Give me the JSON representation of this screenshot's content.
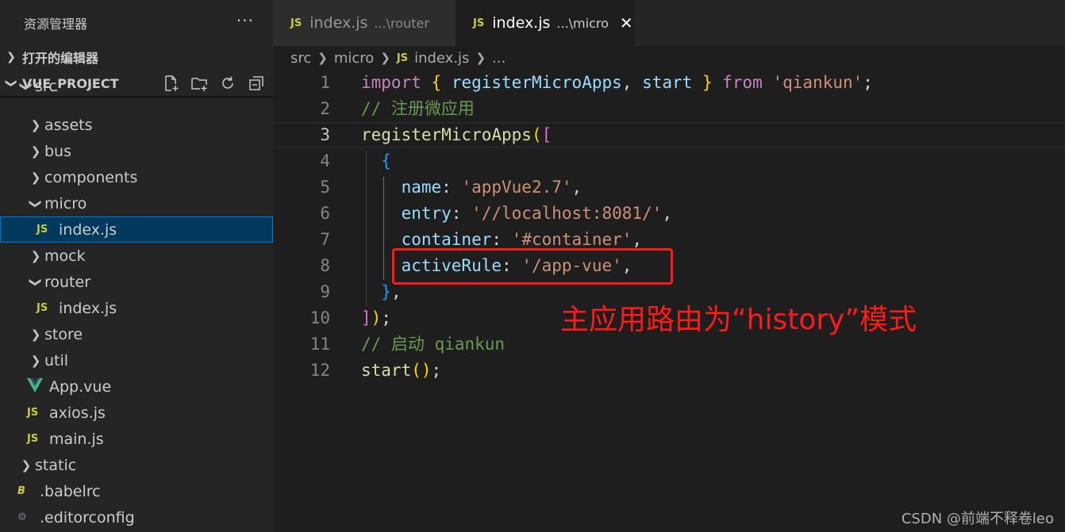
{
  "sidebar": {
    "title": "资源管理器",
    "more_glyph": "···",
    "open_editors_label": "打开的编辑器",
    "project_label": "VUE_PROJECT",
    "actions": [
      "new-file-icon",
      "new-folder-icon",
      "refresh-icon",
      "collapse-all-icon"
    ],
    "tree": [
      {
        "label": "src",
        "kind": "folder",
        "expanded": true,
        "depth": 1,
        "partial": true
      },
      {
        "label": "assets",
        "kind": "folder",
        "expanded": false,
        "depth": 2
      },
      {
        "label": "bus",
        "kind": "folder",
        "expanded": false,
        "depth": 2
      },
      {
        "label": "components",
        "kind": "folder",
        "expanded": false,
        "depth": 2
      },
      {
        "label": "micro",
        "kind": "folder",
        "expanded": true,
        "depth": 2
      },
      {
        "label": "index.js",
        "kind": "js",
        "depth": 3,
        "selected": true
      },
      {
        "label": "mock",
        "kind": "folder",
        "expanded": false,
        "depth": 2
      },
      {
        "label": "router",
        "kind": "folder",
        "expanded": true,
        "depth": 2
      },
      {
        "label": "index.js",
        "kind": "js",
        "depth": 3
      },
      {
        "label": "store",
        "kind": "folder",
        "expanded": false,
        "depth": 2
      },
      {
        "label": "util",
        "kind": "folder",
        "expanded": false,
        "depth": 2
      },
      {
        "label": "App.vue",
        "kind": "vue",
        "depth": 2
      },
      {
        "label": "axios.js",
        "kind": "js",
        "depth": 2
      },
      {
        "label": "main.js",
        "kind": "js",
        "depth": 2
      },
      {
        "label": "static",
        "kind": "folder",
        "expanded": false,
        "depth": 1
      },
      {
        "label": ".babelrc",
        "kind": "babel",
        "depth": 1
      },
      {
        "label": ".editorconfig",
        "kind": "config",
        "depth": 1
      }
    ]
  },
  "tabs": [
    {
      "icon": "JS",
      "label": "index.js",
      "desc": "...\\router",
      "active": false
    },
    {
      "icon": "JS",
      "label": "index.js",
      "desc": "...\\micro",
      "active": true,
      "close": "✕"
    }
  ],
  "breadcrumb": [
    "src",
    "micro",
    "JS",
    "index.js",
    "..."
  ],
  "code": {
    "current_line": 3,
    "lines": [
      {
        "n": "1",
        "tokens": [
          [
            "kw",
            "import"
          ],
          [
            "pn",
            " "
          ],
          [
            "br1",
            "{"
          ],
          [
            "pn",
            " "
          ],
          [
            "id",
            "registerMicroApps"
          ],
          [
            "pn",
            ", "
          ],
          [
            "id",
            "start"
          ],
          [
            "pn",
            " "
          ],
          [
            "br1",
            "}"
          ],
          [
            "pn",
            " "
          ],
          [
            "kw",
            "from"
          ],
          [
            "pn",
            " "
          ],
          [
            "str",
            "'qiankun'"
          ],
          [
            "pn",
            ";"
          ]
        ]
      },
      {
        "n": "2",
        "tokens": [
          [
            "cm",
            "// 注册微应用"
          ]
        ]
      },
      {
        "n": "3",
        "tokens": [
          [
            "fn",
            "registerMicroApps"
          ],
          [
            "br1",
            "("
          ],
          [
            "br2",
            "["
          ]
        ]
      },
      {
        "n": "4",
        "tokens": [
          [
            "pn",
            "  "
          ],
          [
            "br3",
            "{"
          ]
        ]
      },
      {
        "n": "5",
        "tokens": [
          [
            "pn",
            "    "
          ],
          [
            "id",
            "name"
          ],
          [
            "pn",
            ": "
          ],
          [
            "str",
            "'appVue2.7'"
          ],
          [
            "pn",
            ","
          ]
        ]
      },
      {
        "n": "6",
        "tokens": [
          [
            "pn",
            "    "
          ],
          [
            "id",
            "entry"
          ],
          [
            "pn",
            ": "
          ],
          [
            "str",
            "'//localhost:8081/'"
          ],
          [
            "pn",
            ","
          ]
        ]
      },
      {
        "n": "7",
        "tokens": [
          [
            "pn",
            "    "
          ],
          [
            "id",
            "container"
          ],
          [
            "pn",
            ": "
          ],
          [
            "str",
            "'#container'"
          ],
          [
            "pn",
            ","
          ]
        ]
      },
      {
        "n": "8",
        "tokens": [
          [
            "pn",
            "    "
          ],
          [
            "id",
            "activeRule"
          ],
          [
            "pn",
            ": "
          ],
          [
            "str",
            "'/app-vue'"
          ],
          [
            "pn",
            ","
          ]
        ]
      },
      {
        "n": "9",
        "tokens": [
          [
            "pn",
            "  "
          ],
          [
            "br3",
            "}"
          ],
          [
            "pn",
            ","
          ]
        ]
      },
      {
        "n": "10",
        "tokens": [
          [
            "br2",
            "]"
          ],
          [
            "br1",
            ")"
          ],
          [
            "pn",
            ";"
          ]
        ]
      },
      {
        "n": "11",
        "tokens": [
          [
            "cm",
            "// 启动 qiankun"
          ]
        ]
      },
      {
        "n": "12",
        "tokens": [
          [
            "fn",
            "start"
          ],
          [
            "br1",
            "()"
          ],
          [
            "pn",
            ";"
          ]
        ]
      }
    ]
  },
  "annotation": "主应用路由为“history”模式",
  "watermark": "CSDN @前端不释卷leo",
  "colors": {
    "annotation": "#ff1a1a",
    "selection": "#04395e",
    "focus_outline": "#0078d4"
  }
}
